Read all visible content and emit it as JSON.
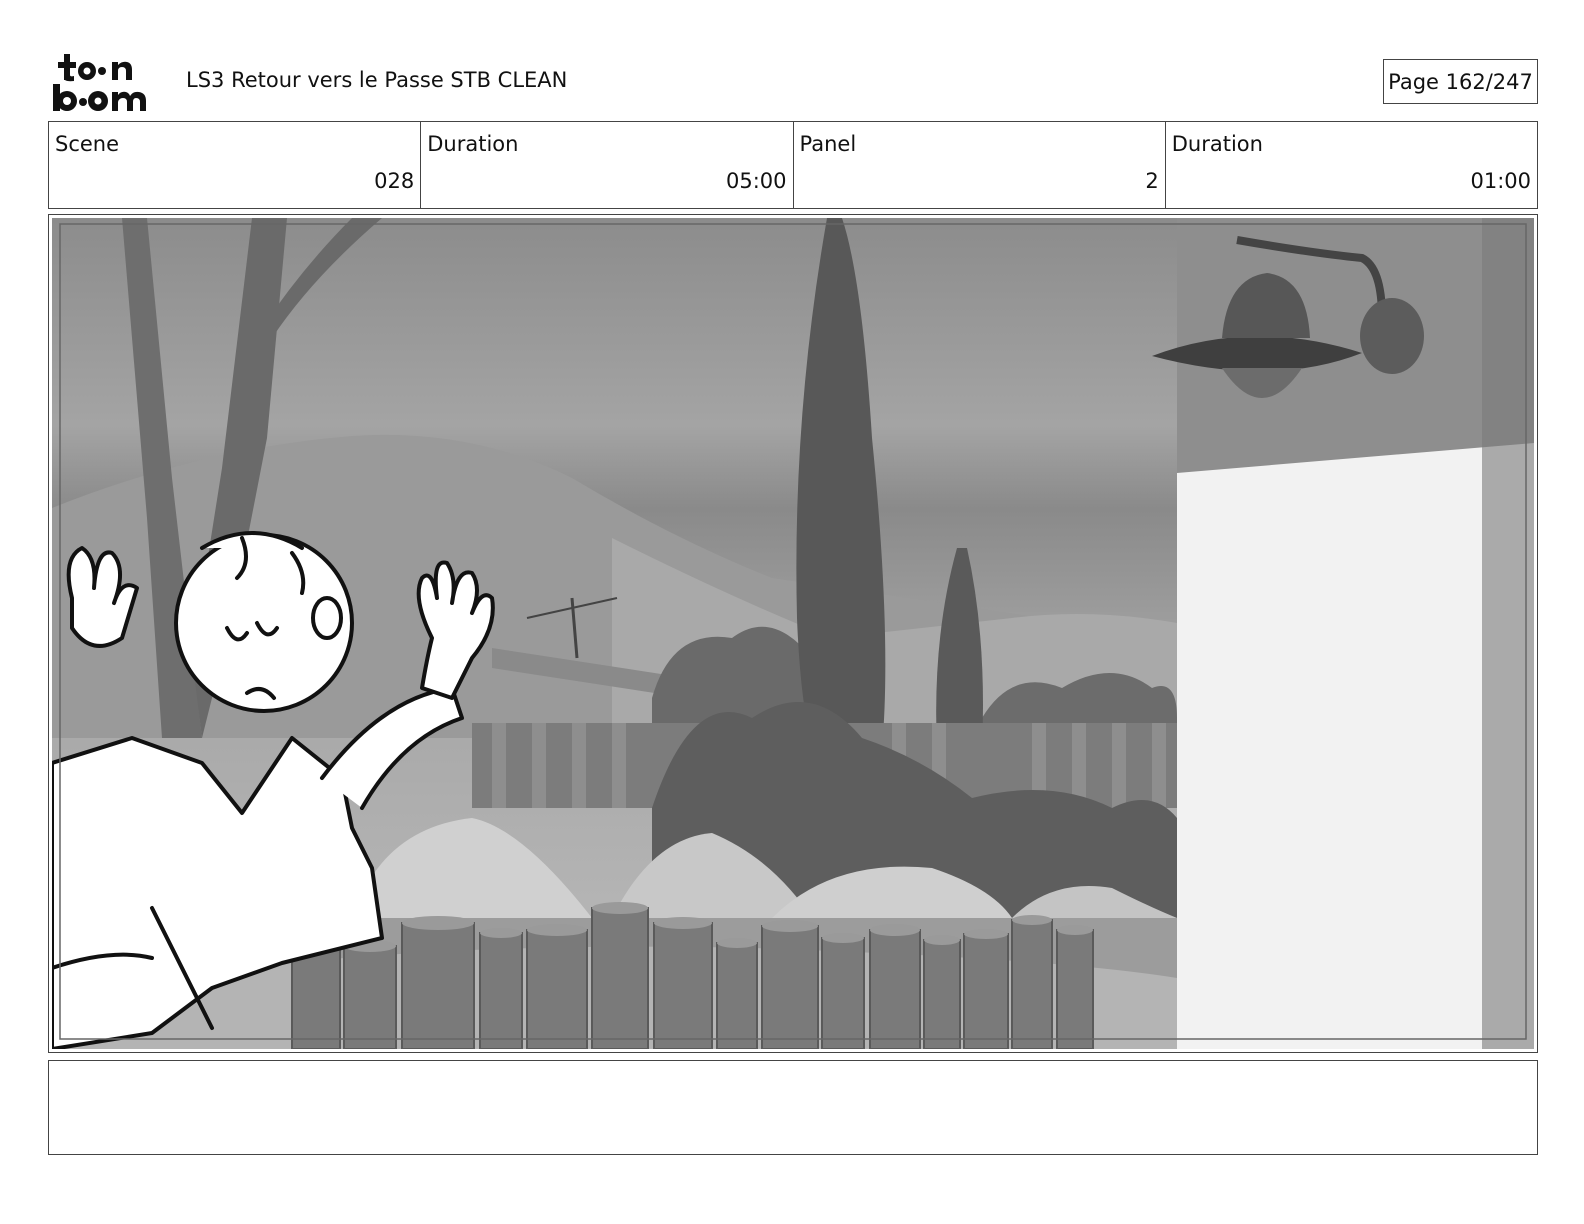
{
  "header": {
    "logo_text": "toonboom",
    "document_title": "LS3 Retour vers le Passe STB CLEAN",
    "page_label": "Page 162/247"
  },
  "info": {
    "scene_label": "Scene",
    "scene_value": "028",
    "scene_duration_label": "Duration",
    "scene_duration_value": "05:00",
    "panel_label": "Panel",
    "panel_value": "2",
    "panel_duration_label": "Duration",
    "panel_duration_value": "01:00"
  },
  "notes": {
    "text": ""
  }
}
